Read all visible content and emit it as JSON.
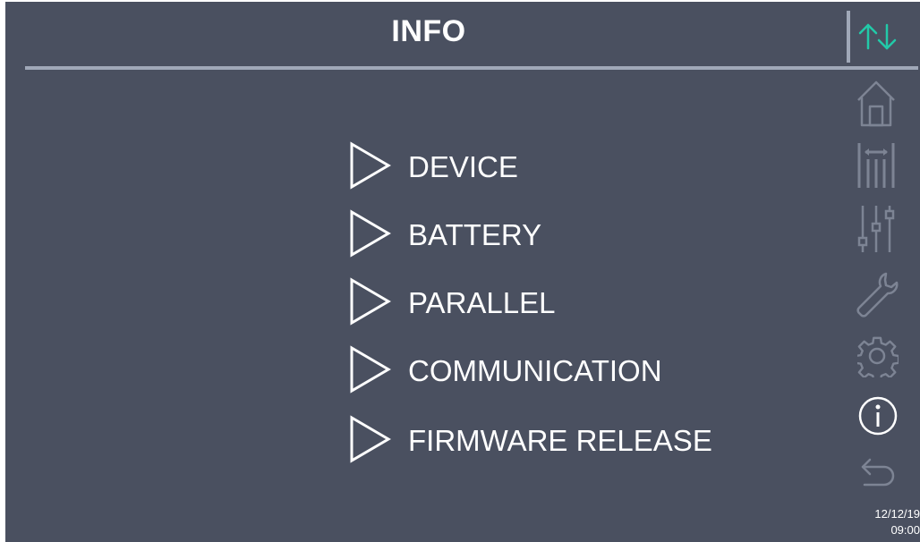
{
  "header": {
    "title": "INFO"
  },
  "menu": {
    "items": [
      {
        "label": "DEVICE"
      },
      {
        "label": "BATTERY"
      },
      {
        "label": "PARALLEL"
      },
      {
        "label": "COMMUNICATION"
      },
      {
        "label": "FIRMWARE RELEASE"
      }
    ]
  },
  "sidebar": {
    "icons": [
      "home-icon",
      "measurements-icon",
      "sliders-icon",
      "wrench-icon",
      "gear-icon",
      "info-icon",
      "back-icon"
    ],
    "active": "info-icon"
  },
  "status": {
    "date": "12/12/19",
    "time": "09:00"
  },
  "colors": {
    "background": "#4a5060",
    "divider": "#a0a8b8",
    "accent": "#22c9a8",
    "inactive_icon": "#7d8494",
    "text": "#ffffff"
  }
}
